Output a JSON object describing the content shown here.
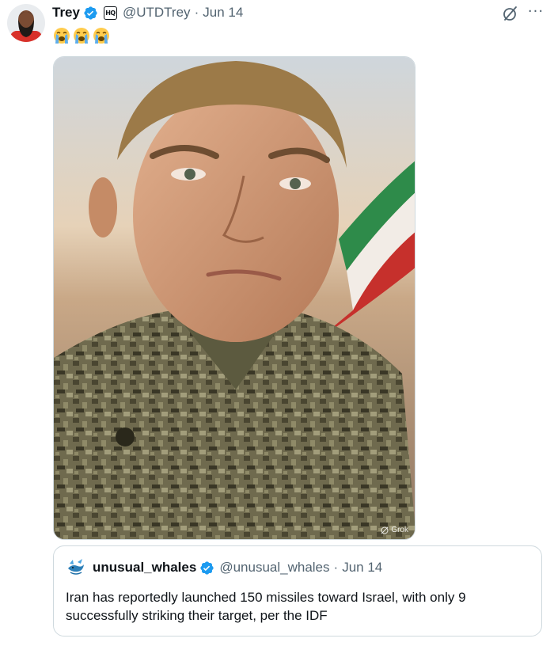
{
  "tweet": {
    "author_name": "Trey",
    "affiliate_badge": "HQ",
    "handle": "@UTDTrey",
    "separator": "·",
    "date": "Jun 14",
    "emojis": [
      "loudly-crying-face-emoji",
      "loudly-crying-face-emoji",
      "loudly-crying-face-emoji"
    ],
    "menu_label": "···",
    "media": {
      "description_icon": "soldier-portrait-photo",
      "watermark": "Grok"
    }
  },
  "quote": {
    "author_name": "unusual_whales",
    "handle": "@unusual_whales",
    "separator": "·",
    "date": "Jun 14",
    "text": "Iran has reportedly launched 150 missiles toward Israel, with only 9 successfully striking their target, per the IDF"
  },
  "colors": {
    "verified_blue": "#1d9bf0",
    "secondary_text": "#536471",
    "border": "#cfd9de"
  }
}
